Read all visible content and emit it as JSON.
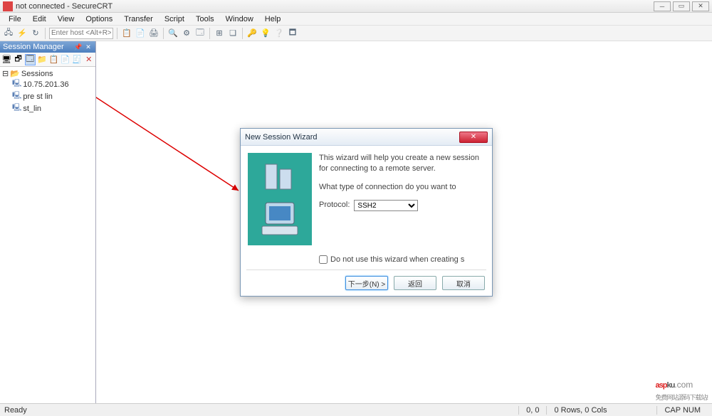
{
  "window": {
    "title": "not connected - SecureCRT"
  },
  "menu": [
    "File",
    "Edit",
    "View",
    "Options",
    "Transfer",
    "Script",
    "Tools",
    "Window",
    "Help"
  ],
  "toolbar": {
    "host_placeholder": "Enter host <Alt+R>"
  },
  "session_manager": {
    "title": "Session Manager",
    "root": "Sessions",
    "items": [
      "10.75.201.36",
      "pre st lin",
      "st_lin"
    ]
  },
  "dialog": {
    "title": "New Session Wizard",
    "intro": "This wizard will help you create a new session for connecting to a remote server.",
    "question": "What type of connection do you want to",
    "protocol_label": "Protocol:",
    "protocol_value": "SSH2",
    "checkbox_label": "Do not use this wizard when creating s",
    "btn_next": "下一步(N) >",
    "btn_back": "返回",
    "btn_cancel": "取消"
  },
  "statusbar": {
    "ready": "Ready",
    "pos": "0, 0",
    "size": "0 Rows, 0 Cols",
    "caps": "CAP NUM"
  },
  "watermark": {
    "brand_red": "asp",
    "brand_dark": "ku",
    "domain": ".com",
    "tagline": "免费网站源码下载站!"
  }
}
